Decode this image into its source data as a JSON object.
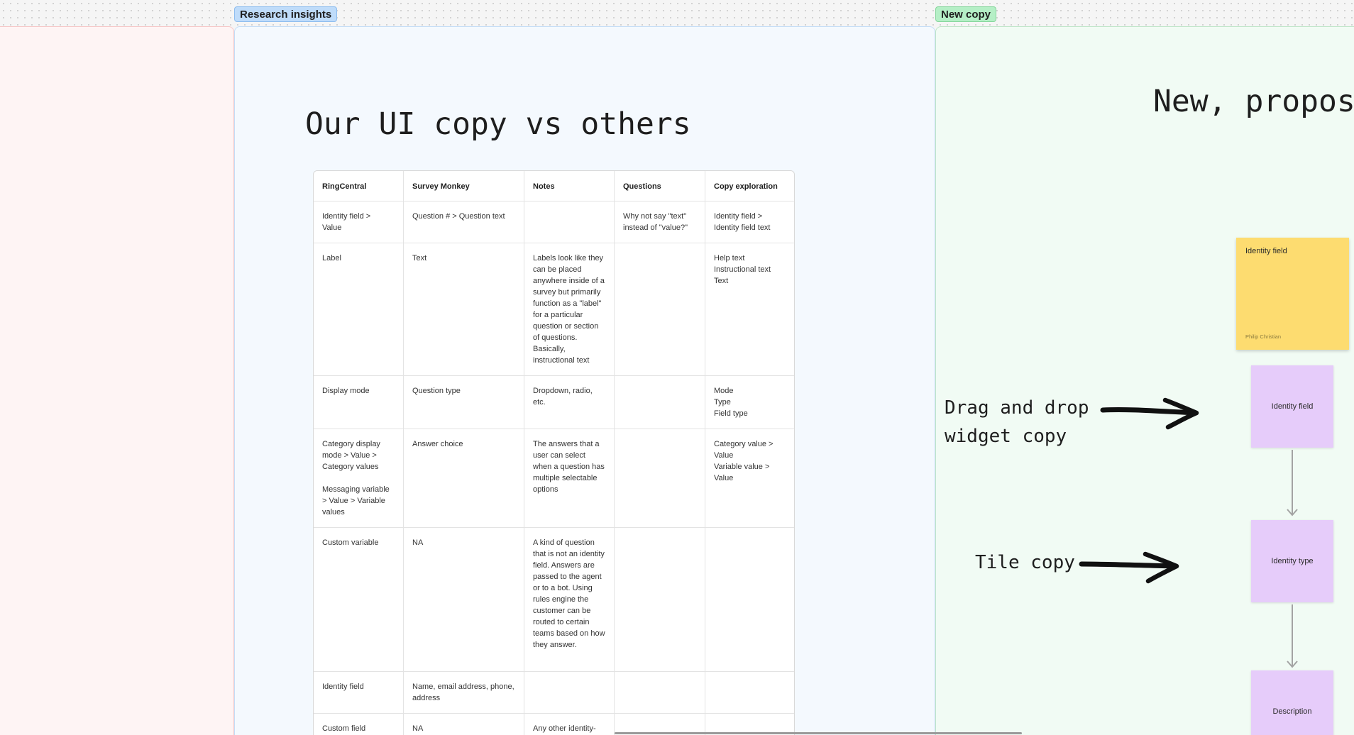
{
  "sections": {
    "research": {
      "tag": "Research insights",
      "title": "Our UI copy vs others"
    },
    "new_copy": {
      "tag": "New copy",
      "title": "New, proposed"
    }
  },
  "table": {
    "headers": [
      "RingCentral",
      "Survey Monkey",
      "Notes",
      "Questions",
      "Copy exploration"
    ],
    "rows": [
      [
        "Identity field >\nValue",
        "Question # > Question text",
        "",
        "Why not say \"text\" instead of \"value?\"",
        "Identity field >\nIdentity field text"
      ],
      [
        "Label",
        "Text",
        "Labels look like they can be placed anywhere inside of a survey but primarily function as a \"label\" for a particular question or section of questions. Basically, instructional text",
        "",
        "Help text\nInstructional text\nText"
      ],
      [
        "Display mode",
        "Question type",
        "Dropdown, radio, etc.",
        "",
        "Mode\nType\nField type"
      ],
      [
        "Category display mode > Value > Category values\n\nMessaging variable > Value > Variable values",
        "Answer choice",
        "The answers that a user can select when a question has multiple selectable options",
        "",
        "Category value >\nValue\nVariable value >\nValue"
      ],
      [
        "Custom variable",
        "NA",
        "A kind of question that is not an identity field. Answers are passed to the agent or to a bot. Using rules engine the customer can be routed to certain teams based on how they answer.",
        "",
        ""
      ],
      [
        "Identity field",
        "Name, email address, phone, address",
        "",
        "",
        ""
      ],
      [
        "Custom field",
        "NA",
        "Any other identity-based question",
        "",
        ""
      ]
    ]
  },
  "annotations": {
    "drag_drop": "Drag and drop\nwidget copy",
    "tile": "Tile copy"
  },
  "stickies": {
    "yellow": {
      "text": "Identity field",
      "author": "Philip Christian",
      "color": "#fddc70"
    },
    "purple": [
      "Identity field",
      "Identity type",
      "Description"
    ],
    "purple_color": "#e6ccfa"
  }
}
